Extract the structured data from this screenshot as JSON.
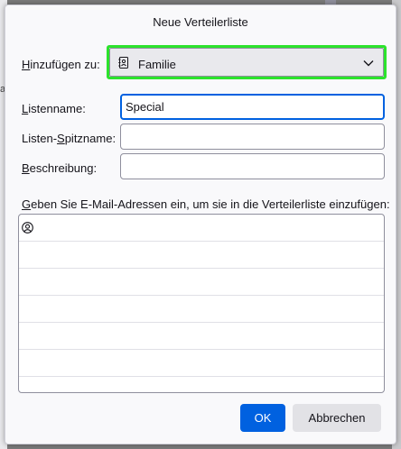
{
  "dialog": {
    "title": "Neue Verteilerliste"
  },
  "form": {
    "addressbook_label_accel": "H",
    "addressbook_label_rest": "inzufügen zu:",
    "addressbook_value": "Familie",
    "listname_label_accel": "L",
    "listname_label_rest": "istenname:",
    "listname_value": "Special",
    "nickname_label_pre": "Listen-",
    "nickname_label_accel": "S",
    "nickname_label_rest": "pitzname:",
    "nickname_value": "",
    "description_label_accel": "B",
    "description_label_rest": "eschreibung:",
    "description_value": ""
  },
  "addresses": {
    "prompt_accel": "G",
    "prompt_rest": "eben Sie E-Mail-Adressen ein, um sie in die Verteilerliste einzufügen:",
    "rows": [
      "",
      "",
      "",
      "",
      "",
      ""
    ]
  },
  "buttons": {
    "ok_label": "OK",
    "cancel_label": "Abbrechen"
  },
  "background": {
    "partial_letter": "a"
  },
  "colors": {
    "accent": "#0061e0",
    "highlight": "#2ce32c"
  },
  "icons": {
    "addressbook": "addressbook-icon",
    "dropdown": "chevron-down-icon",
    "contact": "contact-icon"
  }
}
